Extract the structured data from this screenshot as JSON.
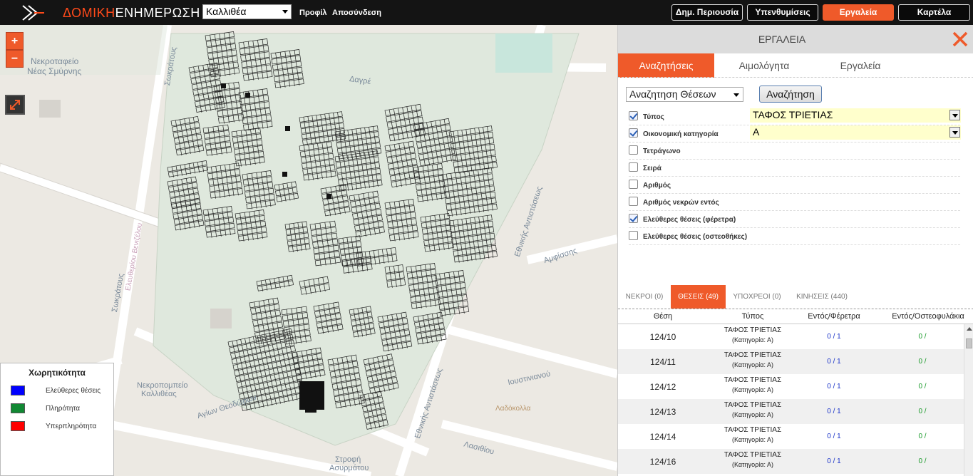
{
  "app": {
    "brand_part1": "ΔΟΜΙΚΗ",
    "brand_part2": "ΕΝΗΜΕΡΩΣΗ",
    "city_selected": "Καλλιθέα",
    "profile_link": "Προφίλ",
    "logout_link": "Αποσύνδεση"
  },
  "nav": {
    "assets": "Δημ. Περιουσία",
    "reminders": "Υπενθυμίσεις",
    "tools": "Εργαλεία",
    "card": "Καρτέλα"
  },
  "map": {
    "zoom_in": "+",
    "zoom_out": "−",
    "labels": {
      "cemetery": "Νεκροταφείο",
      "cemetery2": "Νέας Σμύρνης",
      "street_dagre": "Δαγρέ",
      "street_sokratous": "Σωκράτους",
      "street_sokratous2": "Σωκράτους",
      "street_eleftheriou": "Ελευθερίου Βενιζέλου",
      "street_amfisseos": "Αμφίσσης",
      "street_theodoron": "Αγίων Θεοδώρων",
      "street_eth_antist": "Εθνικής Αντιστάσεως",
      "street_eth_antist2": "Εθνικής Αντιστάσεως",
      "street_ioustinianou": "Ιουστινιανού",
      "street_lasithiou": "Λασιθίου",
      "nekrop": "Νεκροπομπείο",
      "kallitheas": "Καλλιθέας",
      "ladokolla": "Λαδόκολλα",
      "strofi": "Στροφή",
      "asyrmatou": "Ασυρμάτου",
      "agios": "Αγίων Θεοδώρων"
    }
  },
  "legend": {
    "title": "Χωρητικότητα",
    "items": [
      {
        "label": "Ελεύθερες θέσεις",
        "color": "#0000ff"
      },
      {
        "label": "Πληρότητα",
        "color": "#118833"
      },
      {
        "label": "Υπερπληρότητα",
        "color": "#ff0000"
      }
    ]
  },
  "panel": {
    "title": "ΕΡΓΑΛΕΙΑ",
    "tabs": [
      "Αναζητήσεις",
      "Αιμολόγητα",
      "Εργαλεία"
    ],
    "search_type": "Αναζητηση Θέσεων",
    "search_button": "Αναζήτηση",
    "filters": [
      {
        "label": "Τύπος",
        "checked": true,
        "value": "ΤΑΦΟΣ ΤΡΙΕΤΙΑΣ"
      },
      {
        "label": "Οικονομική κατηγορία",
        "checked": true,
        "value": "Α"
      },
      {
        "label": "Τετράγωνο",
        "checked": false,
        "value": ""
      },
      {
        "label": "Σειρά",
        "checked": false,
        "value": ""
      },
      {
        "label": "Αριθμός",
        "checked": false,
        "value": ""
      },
      {
        "label": "Αριθμός νεκρών εντός",
        "checked": false,
        "value": ""
      },
      {
        "label": "Ελεύθερες θέσεις (φέρετρα)",
        "checked": true,
        "value": ""
      },
      {
        "label": "Ελεύθερες θέσεις (οστεοθήκες)",
        "checked": false,
        "value": ""
      }
    ],
    "result_tabs": [
      "ΝΕΚΡΟΙ (0)",
      "ΘΕΣΕΙΣ (49)",
      "ΥΠΟΧΡΕΟΙ (0)",
      "ΚΙΝΗΣΕΙΣ (440)"
    ],
    "columns": [
      "Θέση",
      "Τύπος",
      "Εντός/Φέρετρα",
      "Εντός/Οστεοφυλάκια"
    ],
    "rows": [
      {
        "pos": "124/10",
        "type": "ΤΑΦΟΣ ΤΡΙΕΤΙΑΣ",
        "cat": "(Κατηγορία: Α)",
        "coffins": "0 / 1",
        "ossuary": "0 /"
      },
      {
        "pos": "124/11",
        "type": "ΤΑΦΟΣ ΤΡΙΕΤΙΑΣ",
        "cat": "(Κατηγορία: Α)",
        "coffins": "0 / 1",
        "ossuary": "0 /"
      },
      {
        "pos": "124/12",
        "type": "ΤΑΦΟΣ ΤΡΙΕΤΙΑΣ",
        "cat": "(Κατηγορία: Α)",
        "coffins": "0 / 1",
        "ossuary": "0 /"
      },
      {
        "pos": "124/13",
        "type": "ΤΑΦΟΣ ΤΡΙΕΤΙΑΣ",
        "cat": "(Κατηγορία: Α)",
        "coffins": "0 / 1",
        "ossuary": "0 /"
      },
      {
        "pos": "124/14",
        "type": "ΤΑΦΟΣ ΤΡΙΕΤΙΑΣ",
        "cat": "(Κατηγορία: Α)",
        "coffins": "0 / 1",
        "ossuary": "0 /"
      },
      {
        "pos": "124/16",
        "type": "ΤΑΦΟΣ ΤΡΙΕΤΙΑΣ",
        "cat": "(Κατηγορία: Α)",
        "coffins": "0 / 1",
        "ossuary": "0 /"
      }
    ]
  }
}
